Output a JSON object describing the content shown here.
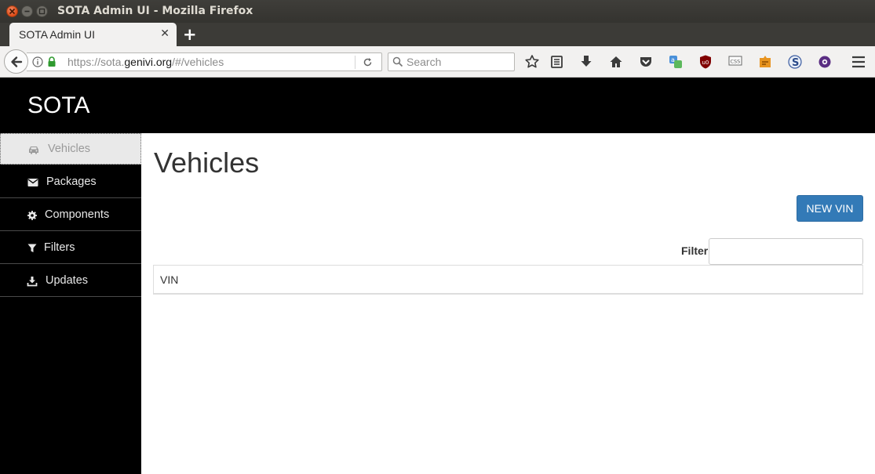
{
  "window": {
    "title": "SOTA Admin UI - Mozilla Firefox"
  },
  "browser": {
    "tab_title": "SOTA Admin UI",
    "tab_close": "✕",
    "new_tab": "+",
    "url_prefix": "https://sota.",
    "url_domain": "genivi.org",
    "url_suffix": "/#/vehicles",
    "search_placeholder": "Search",
    "toolbar_icons": [
      "star-icon",
      "reading-list-icon",
      "download-icon",
      "home-icon",
      "pocket-icon",
      "translate-icon",
      "ublock-icon",
      "css-icon",
      "extension-icon",
      "s-extension-icon",
      "tor-icon",
      "menu-icon"
    ]
  },
  "app": {
    "brand": "SOTA",
    "sidebar": {
      "items": [
        {
          "label": "Vehicles",
          "icon": "car-icon",
          "active": true
        },
        {
          "label": "Packages",
          "icon": "envelope-icon"
        },
        {
          "label": "Components",
          "icon": "gear-icon"
        },
        {
          "label": "Filters",
          "icon": "filter-icon"
        },
        {
          "label": "Updates",
          "icon": "download-tray-icon"
        }
      ]
    },
    "main": {
      "title": "Vehicles",
      "new_vin_button": "NEW VIN",
      "filter_label": "Filter",
      "filter_value": "",
      "table": {
        "columns": [
          "VIN"
        ],
        "rows": []
      }
    }
  },
  "colors": {
    "primary_button": "#337ab7",
    "header_bg": "#000000",
    "sidebar_bg": "#000000"
  }
}
